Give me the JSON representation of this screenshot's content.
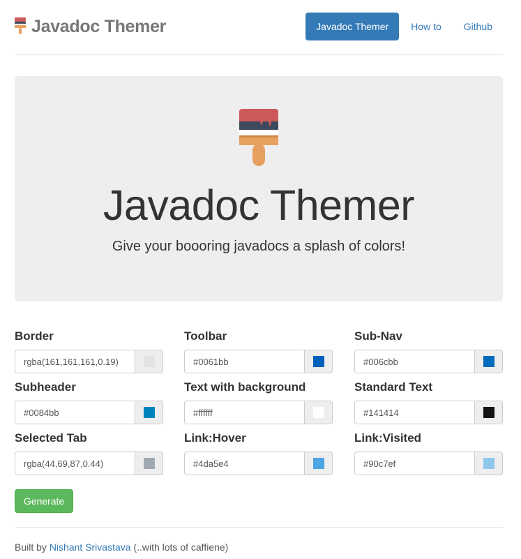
{
  "brand": {
    "title": "Javadoc Themer",
    "icon": "paintbrush-icon"
  },
  "nav": {
    "items": [
      "Javadoc Themer",
      "How to",
      "Github"
    ]
  },
  "jumbotron": {
    "icon": "paintbrush-icon",
    "title": "Javadoc Themer",
    "subtitle": "Give your boooring javadocs a splash of colors!"
  },
  "fields": [
    {
      "label": "Border",
      "value": "rgba(161,161,161,0.19)",
      "swatch": "#e3e3e3"
    },
    {
      "label": "Toolbar",
      "value": "#0061bb",
      "swatch": "#0061bb"
    },
    {
      "label": "Sub-Nav",
      "value": "#006cbb",
      "swatch": "#006cbb"
    },
    {
      "label": "Subheader",
      "value": "#0084bb",
      "swatch": "#0084bb"
    },
    {
      "label": "Text with background",
      "value": "#ffffff",
      "swatch": "#ffffff"
    },
    {
      "label": "Standard Text",
      "value": "#141414",
      "swatch": "#141414"
    },
    {
      "label": "Selected Tab",
      "value": "rgba(44,69,87,0.44)",
      "swatch": "#a0a8b0"
    },
    {
      "label": "Link:Hover",
      "value": "#4da5e4",
      "swatch": "#4da5e4"
    },
    {
      "label": "Link:Visited",
      "value": "#90c7ef",
      "swatch": "#90c7ef"
    }
  ],
  "generate_label": "Generate",
  "footer": {
    "prefix": "Built by",
    "author": "Nishant Srivastava",
    "suffix": "(..with lots of caffiene)"
  },
  "colors": {
    "primary": "#337ab7",
    "success": "#5cb85c",
    "jumbotron_bg": "#eeeeee",
    "brush_red": "#cc5a5a",
    "brush_dark": "#3d4a5e",
    "brush_orange": "#e8a060"
  }
}
